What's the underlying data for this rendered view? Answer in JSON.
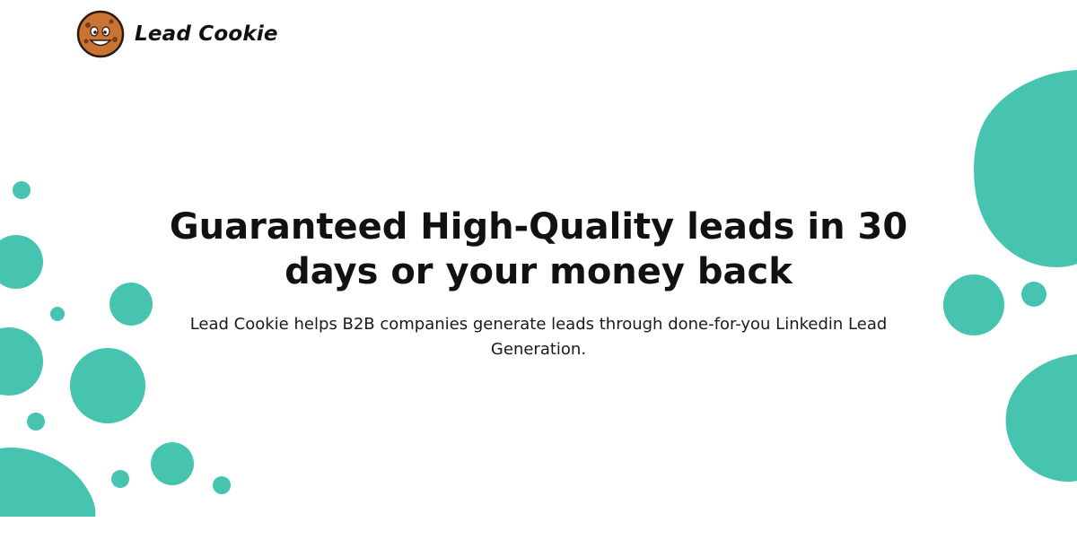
{
  "brand": {
    "name": "Lead Cookie",
    "logo_icon": "cookie-mascot-icon"
  },
  "hero": {
    "headline": "Guaranteed High-Quality leads in 30 days or your money back",
    "subtext": "Lead Cookie helps B2B companies generate leads through done-for-you Linkedin Lead Generation."
  },
  "colors": {
    "accent": "#46c4b0",
    "cookie": "#c97433",
    "text": "#111111",
    "background": "#ffffff"
  }
}
